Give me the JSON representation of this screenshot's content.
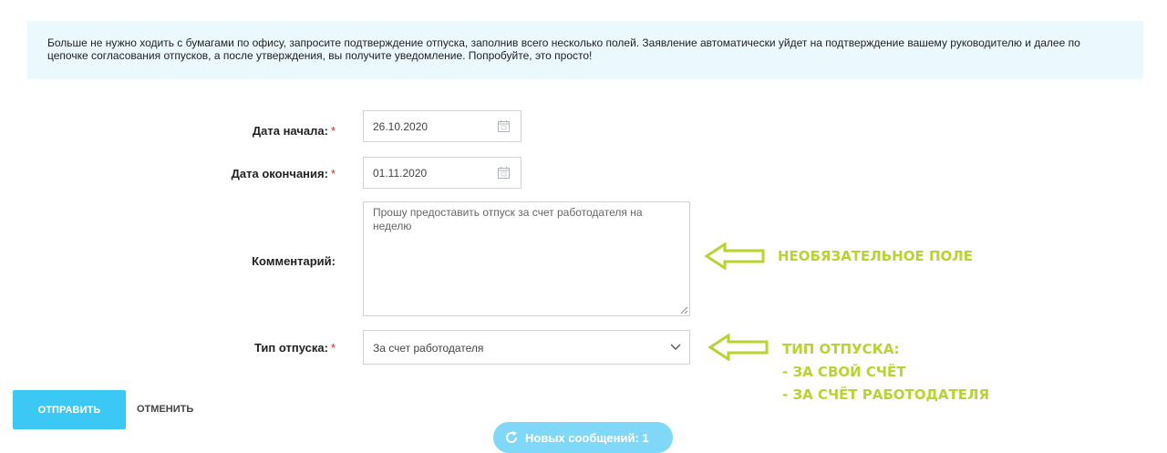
{
  "info": {
    "text": "Больше не нужно ходить с бумагами по офису, запросите подтверждение отпуска, заполнив всего несколько полей. Заявление автоматически уйдет на подтверждение вашему руководителю и далее по цепочке согласования отпусков, а после утверждения, вы получите уведомление. Попробуйте, это просто!"
  },
  "form": {
    "required_mark": "*",
    "start_date": {
      "label": "Дата начала:",
      "value": "26.10.2020"
    },
    "end_date": {
      "label": "Дата окончания:",
      "value": "01.11.2020"
    },
    "comment": {
      "label": "Комментарий:",
      "value": "Прошу предоставить отпуск за счет работодателя на неделю"
    },
    "leave_type": {
      "label": "Тип отпуска:",
      "value": "За счет работодателя"
    }
  },
  "annotations": {
    "optional_field": "НЕОБЯЗАТЕЛЬНОЕ ПОЛЕ",
    "leave_type_title": "ТИП ОТПУСКА:",
    "leave_type_option_1": "- ЗА СВОЙ СЧЁТ",
    "leave_type_option_2": "- ЗА СЧЁТ РАБОТОДАТЕЛЯ",
    "color": "#b8d42f"
  },
  "actions": {
    "submit_label": "ОТПРАВИТЬ",
    "cancel_label": "ОТМЕНИТЬ"
  },
  "notification": {
    "new_messages": "Новых сообщений: 1"
  },
  "colors": {
    "accent": "#3bc8f5",
    "banner_bg": "#ebf8fe",
    "required": "#d9262e"
  },
  "icons": [
    "calendar-icon",
    "resize-handle-icon",
    "chevron-down-icon",
    "arrow-left-icon",
    "refresh-icon"
  ]
}
